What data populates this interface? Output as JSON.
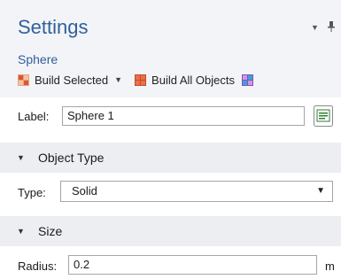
{
  "header": {
    "title": "Settings",
    "subtitle": "Sphere",
    "toolbar": {
      "build_selected_label": "Build Selected",
      "build_all_label": "Build All Objects"
    }
  },
  "label_row": {
    "label": "Label:",
    "value": "Sphere 1"
  },
  "object_type": {
    "section_title": "Object Type",
    "type_label": "Type:",
    "type_value": "Solid"
  },
  "size": {
    "section_title": "Size",
    "radius_label": "Radius:",
    "radius_value": "0.2",
    "radius_unit": "m"
  },
  "colors": {
    "title_blue": "#30609b",
    "header_bg": "#f3f4f7",
    "section_bg": "#eceef2"
  }
}
